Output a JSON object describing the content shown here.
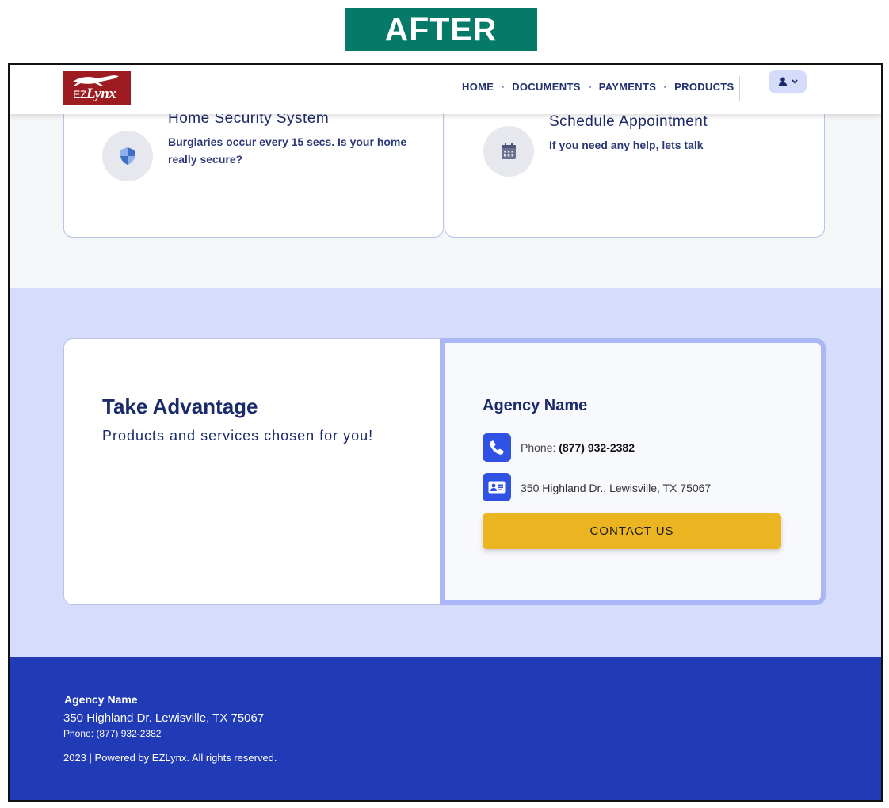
{
  "banner": {
    "label": "AFTER"
  },
  "header": {
    "logo_ez": "EZ",
    "logo_lynx": "Lynx",
    "nav": [
      "HOME",
      "DOCUMENTS",
      "PAYMENTS",
      "PRODUCTS"
    ]
  },
  "cards": [
    {
      "icon": "shield-icon",
      "title": "Home Security System",
      "text": "Burglaries occur every 15 secs. Is your home really secure?"
    },
    {
      "icon": "calendar-icon",
      "title": "Schedule Appointment",
      "text": "If you need any help, lets talk"
    }
  ],
  "advantage": {
    "title": "Take Advantage",
    "subtitle": "Products and services chosen for you!"
  },
  "agency": {
    "name": "Agency Name",
    "phone_label": "Phone:",
    "phone": "(877) 932-2382",
    "address": "350 Highland Dr., Lewisville, TX 75067",
    "contact_label": "CONTACT US"
  },
  "footer": {
    "name": "Agency Name",
    "address": "350 Highland Dr. Lewisville, TX 75067",
    "phone": "Phone: (877) 932-2382",
    "copyright": "2023 | Powered by EZLynx. All rights reserved."
  },
  "colors": {
    "banner": "#057a68",
    "navy": "#1b2a6b",
    "band": "#d6dcfc",
    "accent_blue": "#2f51e4",
    "button_yellow": "#ebb521",
    "footer": "#213ab5",
    "logo_red": "#9c1c22"
  }
}
